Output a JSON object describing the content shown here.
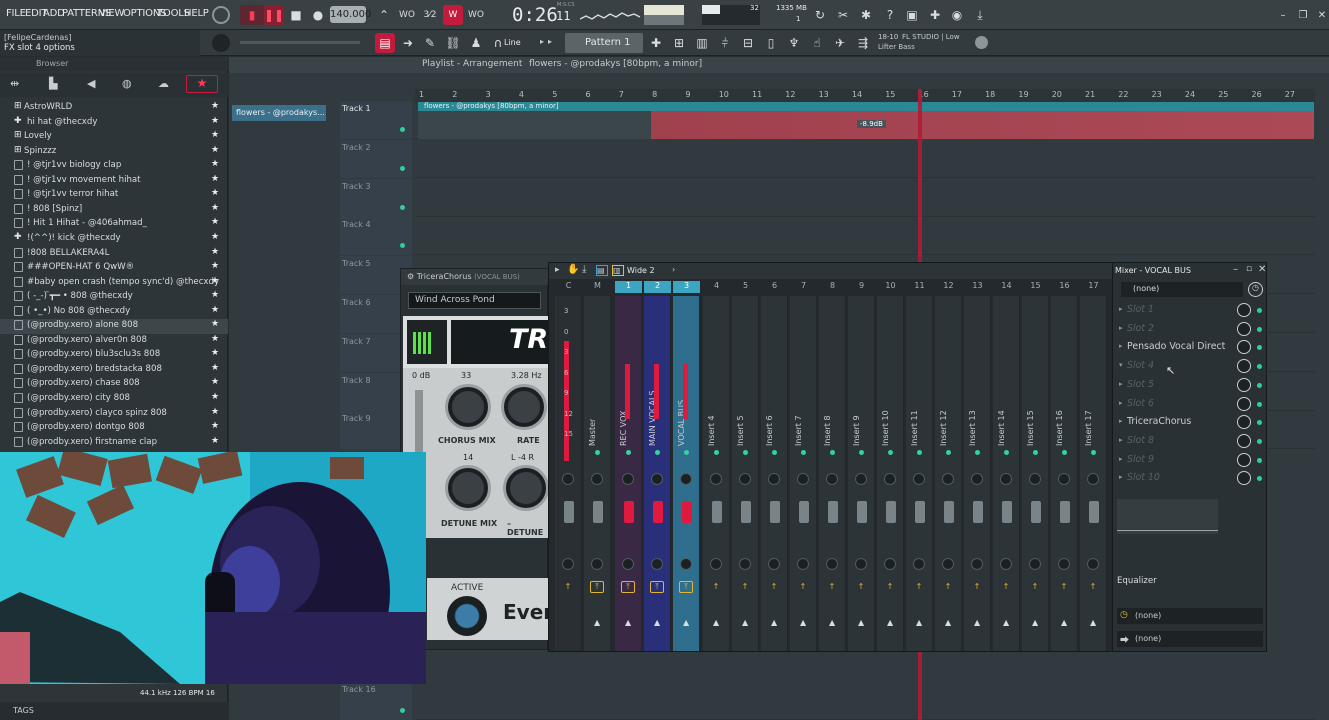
{
  "menu": [
    "FILE",
    "EDIT",
    "ADD",
    "PATTERNS",
    "VIEW",
    "OPTIONS",
    "TOOLS",
    "HELP"
  ],
  "transport": {
    "tempo": "140.000",
    "time": "0:26",
    "time_frac": "11",
    "time_label": "M:S:CS",
    "cpu": "32",
    "mem": "1335 MB",
    "poly": "1"
  },
  "hint": {
    "user": "[FelipeCardenas]",
    "text": "FX slot 4 options"
  },
  "toolbar2": {
    "snap": "Line",
    "pattern": "Pattern 1",
    "news_code": "18-10",
    "news_line1": "FL STUDIO | Low",
    "news_line2": "Lifter Bass"
  },
  "browser": {
    "title": "Browser",
    "items": [
      {
        "label": "AstroWRLD",
        "type": "folder"
      },
      {
        "label": "hi hat @thecxdy",
        "type": "plus"
      },
      {
        "label": "Lovely",
        "type": "folder"
      },
      {
        "label": "Spinzzz",
        "type": "folder"
      },
      {
        "label": "! @tjr1vv biology clap",
        "type": "file"
      },
      {
        "label": "! @tjr1vv movement hihat",
        "type": "file"
      },
      {
        "label": "! @tjr1vv terror hihat",
        "type": "file"
      },
      {
        "label": "! 808 [Spinz]",
        "type": "file"
      },
      {
        "label": "! Hit 1 Hihat - @406ahmad_",
        "type": "file"
      },
      {
        "label": "!(^^)! kick @thecxdy",
        "type": "plus"
      },
      {
        "label": "!808 BELLAKERA4L",
        "type": "file"
      },
      {
        "label": "###OPEN-HAT 6 QwW®",
        "type": "file"
      },
      {
        "label": "#baby open crash (tempo sync'd) @thecxdy",
        "type": "file"
      },
      {
        "label": "( -_-)  ̄┳━ • 808 @thecxdy",
        "type": "file"
      },
      {
        "label": "( •_•) No 808 @thecxdy",
        "type": "file"
      },
      {
        "label": "(@prodby.xero) alone 808",
        "type": "file"
      },
      {
        "label": "(@prodby.xero) alver0n 808",
        "type": "file"
      },
      {
        "label": "(@prodby.xero) blu3sclu3s 808",
        "type": "file"
      },
      {
        "label": "(@prodby.xero) bredstacka 808",
        "type": "file"
      },
      {
        "label": "(@prodby.xero) chase 808",
        "type": "file"
      },
      {
        "label": "(@prodby.xero) city 808",
        "type": "file"
      },
      {
        "label": "(@prodby.xero) clayco spinz 808",
        "type": "file"
      },
      {
        "label": "(@prodby.xero) dontgo 808",
        "type": "file"
      },
      {
        "label": "(@prodby.xero) firstname clap",
        "type": "file"
      }
    ],
    "tags": "TAGS",
    "status": "44.1 kHz 126 BPM 16"
  },
  "playlist": {
    "title": "Playlist - Arrangement",
    "breadcrumb": "flowers - @prodakys [80bpm, a minor]",
    "clip": "flowers - @prodakys [80bpm, a minor]",
    "pattern_tab": "flowers - @prodakys...",
    "clip_db": "-8.9dB",
    "tracks": [
      "Track 1",
      "Track 2",
      "Track 3",
      "Track 4",
      "Track 5",
      "Track 6",
      "Track 7",
      "Track 8",
      "Track 9",
      "Track 16"
    ],
    "ruler": [
      "1",
      "2",
      "3",
      "4",
      "5",
      "6",
      "7",
      "8",
      "9",
      "10",
      "11",
      "12",
      "13",
      "14",
      "15",
      "16",
      "17",
      "18",
      "19",
      "20",
      "21",
      "22",
      "23",
      "24",
      "25",
      "26",
      "27"
    ]
  },
  "fx": {
    "title": "TriceraChorus",
    "subtitle": "(VOCAL BUS)",
    "preset": "Wind Across Pond",
    "logo": "TR",
    "db": "0 dB",
    "rate_hz": "3.28 Hz",
    "k1_value": "33",
    "k1": "CHORUS MIX",
    "k2": "RATE",
    "k3_value": "14",
    "k4_value": "L -4 R",
    "k3": "DETUNE MIX",
    "k4": "– DETUNE",
    "active": "ACTIVE",
    "brand": "Even"
  },
  "mixer": {
    "title": "Mixer - VOCAL BUS",
    "layout": "Wide 2",
    "scale": [
      "3",
      "0",
      "3",
      "6",
      "9",
      "12",
      "15"
    ],
    "strips": [
      {
        "num": "C",
        "name": ""
      },
      {
        "num": "M",
        "name": "Master"
      },
      {
        "num": "1",
        "name": "REC VOX"
      },
      {
        "num": "2",
        "name": "MAIN VOCALS"
      },
      {
        "num": "3",
        "name": "VOCAL BUS"
      },
      {
        "num": "4",
        "name": "Insert 4"
      },
      {
        "num": "5",
        "name": "Insert 5"
      },
      {
        "num": "6",
        "name": "Insert 6"
      },
      {
        "num": "7",
        "name": "Insert 7"
      },
      {
        "num": "8",
        "name": "Insert 8"
      },
      {
        "num": "9",
        "name": "Insert 9"
      },
      {
        "num": "10",
        "name": "Insert 10"
      },
      {
        "num": "11",
        "name": "Insert 11"
      },
      {
        "num": "12",
        "name": "Insert 12"
      },
      {
        "num": "13",
        "name": "Insert 13"
      },
      {
        "num": "14",
        "name": "Insert 14"
      },
      {
        "num": "15",
        "name": "Insert 15"
      },
      {
        "num": "16",
        "name": "Insert 16"
      },
      {
        "num": "17",
        "name": "Insert 17"
      }
    ],
    "input": "(none)",
    "slots": [
      {
        "label": "Slot 1",
        "on": false
      },
      {
        "label": "Slot 2",
        "on": false
      },
      {
        "label": "Pensado Vocal Direct",
        "on": true
      },
      {
        "label": "Slot 4",
        "on": false
      },
      {
        "label": "Slot 5",
        "on": false
      },
      {
        "label": "Slot 6",
        "on": false
      },
      {
        "label": "TriceraChorus",
        "on": true
      },
      {
        "label": "Slot 8",
        "on": false
      },
      {
        "label": "Slot 9",
        "on": false
      },
      {
        "label": "Slot 10",
        "on": false
      }
    ],
    "eq": "Equalizer",
    "out1": "(none)",
    "out2": "(none)"
  },
  "colors": {
    "accent_red": "#e0193f",
    "accent_cyan": "#2fd3a3",
    "selected": "#3b8fb3"
  }
}
